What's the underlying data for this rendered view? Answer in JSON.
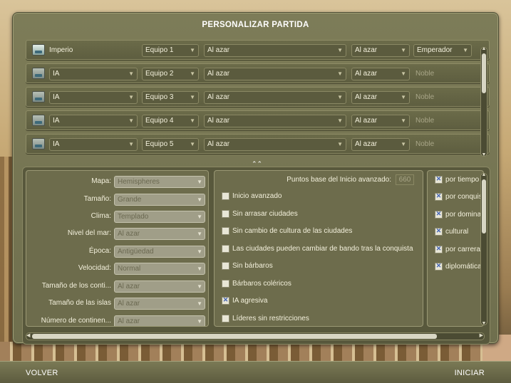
{
  "title": "PERSONALIZAR PARTIDA",
  "players": [
    {
      "name": "Imperio",
      "team": "Equipo 1",
      "civ": "Al azar",
      "leader": "Al azar",
      "difficulty": "Emperador",
      "active": true
    },
    {
      "name": "IA",
      "team": "Equipo 2",
      "civ": "Al azar",
      "leader": "Al azar",
      "difficulty": "Noble",
      "active": false
    },
    {
      "name": "IA",
      "team": "Equipo 3",
      "civ": "Al azar",
      "leader": "Al azar",
      "difficulty": "Noble",
      "active": false
    },
    {
      "name": "IA",
      "team": "Equipo 4",
      "civ": "Al azar",
      "leader": "Al azar",
      "difficulty": "Noble",
      "active": false
    },
    {
      "name": "IA",
      "team": "Equipo 5",
      "civ": "Al azar",
      "leader": "Al azar",
      "difficulty": "Noble",
      "active": false
    }
  ],
  "map_settings": [
    {
      "label": "Mapa:",
      "value": "Hemispheres"
    },
    {
      "label": "Tamaño:",
      "value": "Grande"
    },
    {
      "label": "Clima:",
      "value": "Templado"
    },
    {
      "label": "Nivel del mar:",
      "value": "Al azar"
    },
    {
      "label": "Época:",
      "value": "Antigüedad"
    },
    {
      "label": "Velocidad:",
      "value": "Normal"
    },
    {
      "label": "Tamaño de los conti...",
      "value": "Al azar"
    },
    {
      "label": "Tamaño de las islas",
      "value": "Al azar"
    },
    {
      "label": "Número de continen...",
      "value": "Al azar"
    }
  ],
  "options": {
    "advanced_start_label": "Puntos base del Inicio avanzado:",
    "advanced_start_value": "660",
    "items": [
      {
        "label": "Inicio avanzado",
        "checked": false
      },
      {
        "label": "Sin arrasar ciudades",
        "checked": false
      },
      {
        "label": "Sin cambio de cultura de las ciudades",
        "checked": false
      },
      {
        "label": "Las ciudades pueden cambiar de bando tras la conquista",
        "checked": false
      },
      {
        "label": "Sin bárbaros",
        "checked": false
      },
      {
        "label": "Bárbaros coléricos",
        "checked": false
      },
      {
        "label": "IA agresiva",
        "checked": true
      },
      {
        "label": "Líderes sin restricciones",
        "checked": false
      }
    ]
  },
  "victories": [
    {
      "label": "por tiempo",
      "checked": true
    },
    {
      "label": "por conquista",
      "checked": true
    },
    {
      "label": "por dominación",
      "checked": true
    },
    {
      "label": "cultural",
      "checked": true
    },
    {
      "label": "por carrera espacial",
      "checked": true
    },
    {
      "label": "diplomática",
      "checked": true
    }
  ],
  "footer": {
    "back": "VOLVER",
    "start": "INICIAR"
  },
  "icons": {
    "dropdown": "chevron-down-icon",
    "collapse": "double-chevron-up-icon"
  }
}
